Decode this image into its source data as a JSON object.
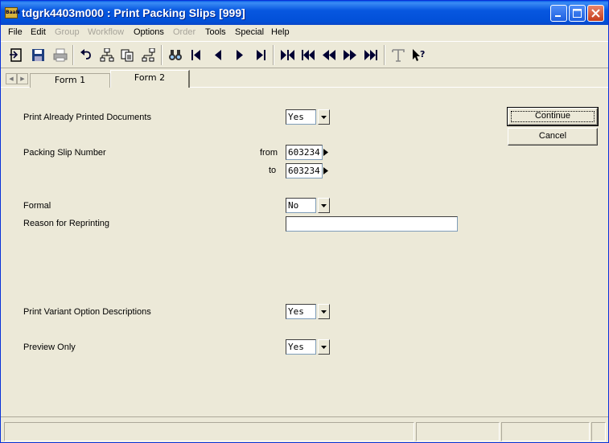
{
  "window": {
    "title": "tdgrk4403m000 : Print Packing Slips [999]",
    "app_icon_text": "BaaN"
  },
  "menu": [
    {
      "label": "File",
      "enabled": true
    },
    {
      "label": "Edit",
      "enabled": true
    },
    {
      "label": "Group",
      "enabled": false
    },
    {
      "label": "Workflow",
      "enabled": false
    },
    {
      "label": "Options",
      "enabled": true
    },
    {
      "label": "Order",
      "enabled": false
    },
    {
      "label": "Tools",
      "enabled": true
    },
    {
      "label": "Special",
      "enabled": true
    },
    {
      "label": "Help",
      "enabled": true
    }
  ],
  "toolbar_icons": [
    "exit-icon",
    "save-icon",
    "print-icon",
    "undo-icon",
    "insert-icon",
    "copy-icon",
    "move-icon",
    "find-icon",
    "first-record-icon",
    "previous-record-icon",
    "next-record-icon",
    "last-record-icon",
    "first-set-icon",
    "previous-set-icon",
    "rewind-icon",
    "forward-icon",
    "next-set-icon",
    "text-icon",
    "whats-this-icon"
  ],
  "tabs": [
    {
      "label": "Form 1",
      "active": false
    },
    {
      "label": "Form 2",
      "active": true
    }
  ],
  "form": {
    "print_already_printed": {
      "label": "Print Already Printed Documents",
      "value": "Yes"
    },
    "packing_slip": {
      "label": "Packing Slip Number",
      "from_label": "from",
      "from_value": "603234",
      "to_label": "to",
      "to_value": "603234"
    },
    "formal": {
      "label": "Formal",
      "value": "No"
    },
    "reason": {
      "label": "Reason for Reprinting",
      "value": ""
    },
    "variant_desc": {
      "label": "Print Variant Option Descriptions",
      "value": "Yes"
    },
    "preview_only": {
      "label": "Preview Only",
      "value": "Yes"
    }
  },
  "buttons": {
    "continue": "Continue",
    "cancel": "Cancel"
  },
  "colors": {
    "title_blue": "#0757e0",
    "face": "#ece9d8"
  }
}
